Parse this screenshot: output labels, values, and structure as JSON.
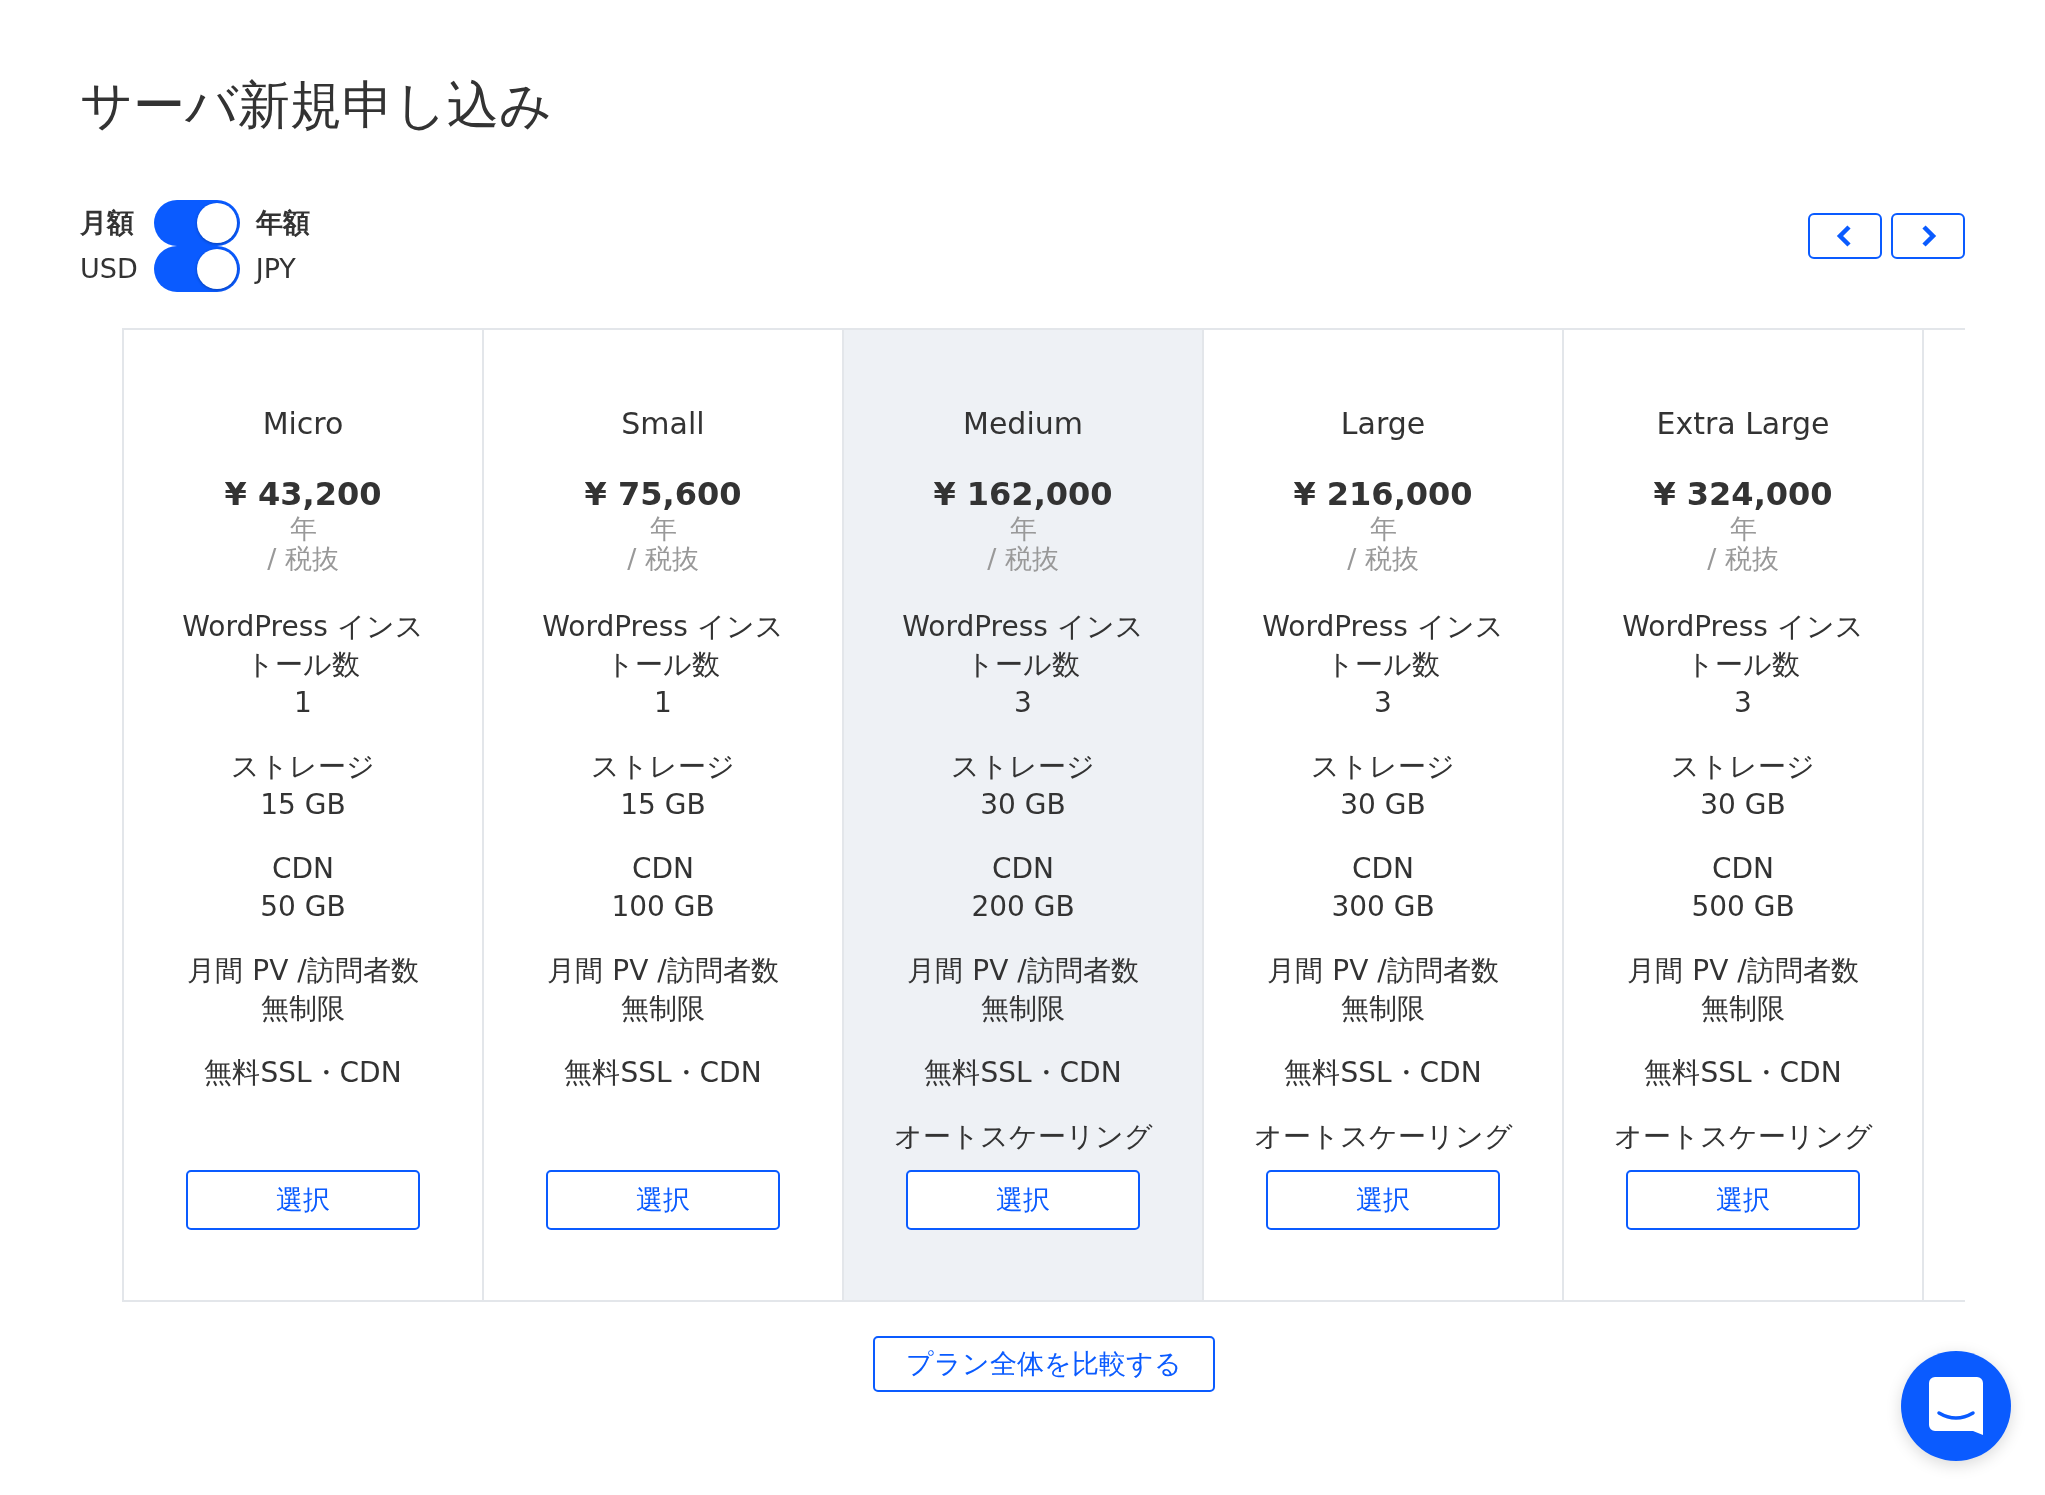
{
  "title": "サーバ新規申し込み",
  "toggles": [
    {
      "left": "月額",
      "right": "年額",
      "on": true
    },
    {
      "left": "USD",
      "right": "JPY",
      "on": true
    }
  ],
  "plans": [
    {
      "name": "Micro",
      "price": "¥ 43,200",
      "period": "年",
      "tax": "/ 税抜",
      "selected": false,
      "features": [
        {
          "label": "WordPress インストール数",
          "value": "1"
        },
        {
          "label": "ストレージ",
          "value": "15 GB"
        },
        {
          "label": "CDN",
          "value": "50 GB"
        },
        {
          "label": "月間 PV /訪問者数",
          "value": "無制限"
        },
        {
          "label": "無料SSL・CDN"
        }
      ],
      "button": "選択"
    },
    {
      "name": "Small",
      "price": "¥ 75,600",
      "period": "年",
      "tax": "/ 税抜",
      "selected": false,
      "features": [
        {
          "label": "WordPress インストール数",
          "value": "1"
        },
        {
          "label": "ストレージ",
          "value": "15 GB"
        },
        {
          "label": "CDN",
          "value": "100 GB"
        },
        {
          "label": "月間 PV /訪問者数",
          "value": "無制限"
        },
        {
          "label": "無料SSL・CDN"
        }
      ],
      "button": "選択"
    },
    {
      "name": "Medium",
      "price": "¥ 162,000",
      "period": "年",
      "tax": "/ 税抜",
      "selected": true,
      "features": [
        {
          "label": "WordPress インストール数",
          "value": "3"
        },
        {
          "label": "ストレージ",
          "value": "30 GB"
        },
        {
          "label": "CDN",
          "value": "200 GB"
        },
        {
          "label": "月間 PV /訪問者数",
          "value": "無制限"
        },
        {
          "label": "無料SSL・CDN"
        },
        {
          "label": "オートスケーリング"
        }
      ],
      "button": "選択"
    },
    {
      "name": "Large",
      "price": "¥ 216,000",
      "period": "年",
      "tax": "/ 税抜",
      "selected": false,
      "features": [
        {
          "label": "WordPress インストール数",
          "value": "3"
        },
        {
          "label": "ストレージ",
          "value": "30 GB"
        },
        {
          "label": "CDN",
          "value": "300 GB"
        },
        {
          "label": "月間 PV /訪問者数",
          "value": "無制限"
        },
        {
          "label": "無料SSL・CDN"
        },
        {
          "label": "オートスケーリング"
        }
      ],
      "button": "選択"
    },
    {
      "name": "Extra Large",
      "price": "¥ 324,000",
      "period": "年",
      "tax": "/ 税抜",
      "selected": false,
      "features": [
        {
          "label": "WordPress インストール数",
          "value": "3"
        },
        {
          "label": "ストレージ",
          "value": "30 GB"
        },
        {
          "label": "CDN",
          "value": "500 GB"
        },
        {
          "label": "月間 PV /訪問者数",
          "value": "無制限"
        },
        {
          "label": "無料SSL・CDN"
        },
        {
          "label": "オートスケーリング"
        }
      ],
      "button": "選択"
    }
  ],
  "compare_button": "プラン全体を比較する"
}
